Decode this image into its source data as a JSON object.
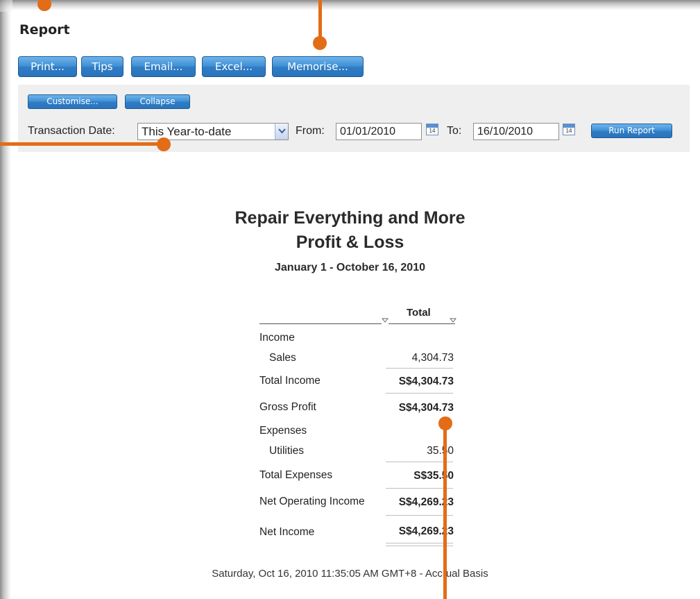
{
  "page": {
    "title": "Report"
  },
  "toolbar": {
    "print": "Print...",
    "tips": "Tips",
    "email": "Email...",
    "excel": "Excel...",
    "memorise": "Memorise..."
  },
  "filters": {
    "customise": "Customise...",
    "collapse": "Collapse",
    "transaction_date_label": "Transaction Date:",
    "transaction_date_value": "This Year-to-date",
    "from_label": "From:",
    "from_value": "01/01/2010",
    "to_label": "To:",
    "to_value": "16/10/2010",
    "calendar_day": "14",
    "run_report": "Run Report"
  },
  "report": {
    "company": "Repair Everything and More",
    "name": "Profit & Loss",
    "period": "January 1 - October 16, 2010",
    "column_header": "Total",
    "rows": [
      {
        "label": "Income",
        "value": ""
      },
      {
        "label": "Sales",
        "value": "4,304.73"
      },
      {
        "label": "Total Income",
        "value": "S$4,304.73"
      },
      {
        "label": "Gross Profit",
        "value": "S$4,304.73"
      },
      {
        "label": "Expenses",
        "value": ""
      },
      {
        "label": "Utilities",
        "value": "35.50"
      },
      {
        "label": "Total Expenses",
        "value": "S$35.50"
      },
      {
        "label": "Net Operating Income",
        "value": "S$4,269.23"
      },
      {
        "label": "Net Income",
        "value": "S$4,269.23"
      }
    ],
    "footer": "Saturday, Oct 16, 2010 11:35:05 AM GMT+8 - Accrual Basis"
  },
  "colors": {
    "button_blue": "#3f8fd4",
    "callout_orange": "#e36c16",
    "panel_gray": "#efefef"
  }
}
